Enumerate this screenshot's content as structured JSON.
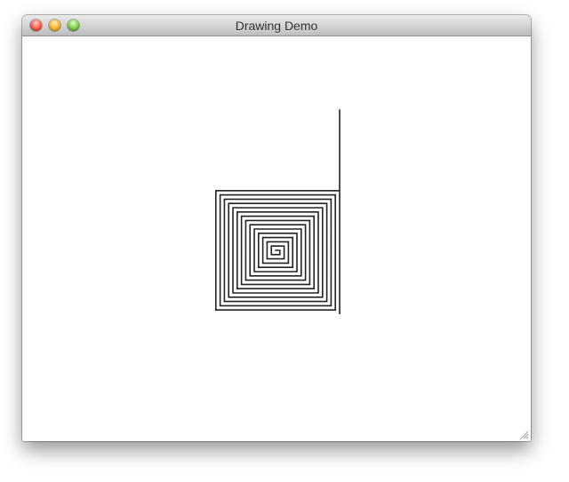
{
  "window": {
    "title": "Drawing Demo"
  },
  "titlebar_buttons": [
    {
      "name": "close",
      "icon": "close-icon",
      "color": "#ff5f57"
    },
    {
      "name": "minimize",
      "icon": "minimize-icon",
      "color": "#febc2e"
    },
    {
      "name": "zoom",
      "icon": "zoom-icon",
      "color": "#28c840"
    }
  ],
  "drawing": {
    "shape": "square spiral",
    "stroke_color": "#222222"
  }
}
